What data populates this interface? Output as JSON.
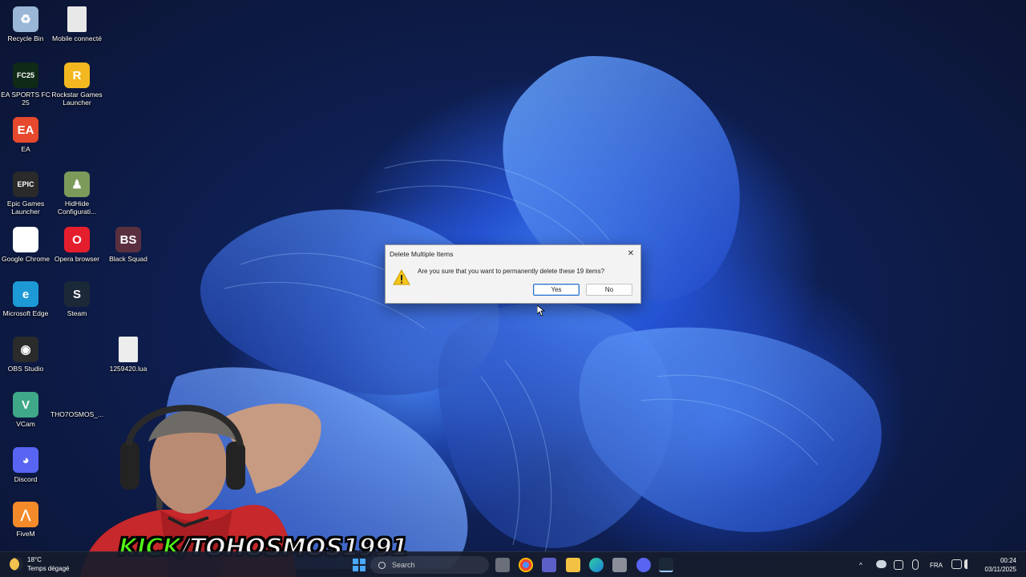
{
  "desktop": {
    "icons": [
      {
        "label": "Recycle Bin",
        "glyph": "♻",
        "color": "#9ab7d8"
      },
      {
        "label": "Mobile connecté",
        "glyph": "",
        "color": "#e8e8e8"
      },
      {
        "label": "EA SPORTS FC 25",
        "glyph": "FC25",
        "color": "#0f2a16"
      },
      {
        "label": "Rockstar Games Launcher",
        "glyph": "R",
        "color": "#f3b820"
      },
      {
        "label": "EA",
        "glyph": "EA",
        "color": "#e6492d"
      },
      {
        "label": "Epic Games Launcher",
        "glyph": "EPIC",
        "color": "#2a2a2a"
      },
      {
        "label": "HidHide Configurati...",
        "glyph": "♟",
        "color": "#7c9a5a"
      },
      {
        "label": "Google Chrome",
        "glyph": "●",
        "color": "#ffffff"
      },
      {
        "label": "Opera browser",
        "glyph": "O",
        "color": "#e51e2d"
      },
      {
        "label": "Black Squad",
        "glyph": "BS",
        "color": "#5a3040"
      },
      {
        "label": "Microsoft Edge",
        "glyph": "e",
        "color": "#1d9ad6"
      },
      {
        "label": "Steam",
        "glyph": "S",
        "color": "#1b2838"
      },
      {
        "label": "OBS Studio",
        "glyph": "◉",
        "color": "#2b2b2b"
      },
      {
        "label": "1259420.lua",
        "glyph": "",
        "color": "#ededed"
      },
      {
        "label": "VCam",
        "glyph": "V",
        "color": "#3fa888"
      },
      {
        "label": "THO7OSMOS_...",
        "glyph": "",
        "color": "transparent"
      },
      {
        "label": "Discord",
        "glyph": "◕",
        "color": "#5865f2"
      },
      {
        "label": "FiveM",
        "glyph": "⋀",
        "color": "#f48a2a"
      }
    ]
  },
  "dialog": {
    "title": "Delete Multiple Items",
    "message": "Are you sure that you want to permanently delete these 19 items?",
    "yes_label": "Yes",
    "no_label": "No",
    "close_glyph": "✕"
  },
  "overlay": {
    "kick_prefix": "KICK",
    "kick_rest": "/TOHOSMOS1991"
  },
  "taskbar": {
    "weather_temp": "18°C",
    "weather_desc": "Temps dégagé",
    "search_placeholder": "Search",
    "language": "FRA",
    "time": "00:24",
    "date": "03/11/2025",
    "tray_chevron": "^"
  },
  "colors": {
    "accent": "#2a6fd1",
    "kick_green": "#53fc18"
  }
}
